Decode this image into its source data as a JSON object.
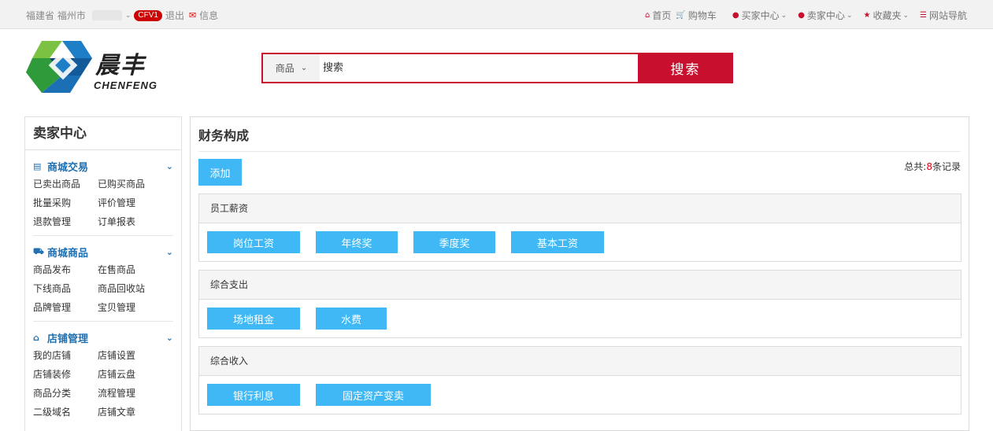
{
  "topbar": {
    "location": "福建省 福州市",
    "badge": "CFV1",
    "logout": "退出",
    "message": "信息",
    "nav": [
      {
        "icon": "home-icon",
        "glyph": "⌂",
        "label": "首页",
        "dropdown": false
      },
      {
        "icon": "cart-icon",
        "glyph": "🛒",
        "label": "购物车",
        "dropdown": false
      },
      {
        "icon": "user-icon",
        "glyph": "●",
        "label": "买家中心",
        "dropdown": true
      },
      {
        "icon": "user-icon",
        "glyph": "●",
        "label": "卖家中心",
        "dropdown": true
      },
      {
        "icon": "star-icon",
        "glyph": "★",
        "label": "收藏夹",
        "dropdown": true
      },
      {
        "icon": "list-icon",
        "glyph": "☰",
        "label": "网站导航",
        "dropdown": false
      }
    ]
  },
  "logo": {
    "cn": "晨丰",
    "en": "CHENFENG"
  },
  "search": {
    "category": "商品",
    "placeholder": "搜索",
    "button": "搜索"
  },
  "sidebar": {
    "title": "卖家中心",
    "groups": [
      {
        "icon": "card-icon",
        "title": "商城交易",
        "links": [
          "已卖出商品",
          "已购买商品",
          "批量采购",
          "评价管理",
          "退款管理",
          "订单报表"
        ]
      },
      {
        "icon": "truck-icon",
        "title": "商城商品",
        "links": [
          "商品发布",
          "在售商品",
          "下线商品",
          "商品回收站",
          "品牌管理",
          "宝贝管理"
        ]
      },
      {
        "icon": "home-icon",
        "title": "店铺管理",
        "links": [
          "我的店铺",
          "店铺设置",
          "店铺装修",
          "店铺云盘",
          "商品分类",
          "流程管理",
          "二级域名",
          "店铺文章"
        ]
      }
    ]
  },
  "main": {
    "title": "财务构成",
    "add_button": "添加",
    "total_prefix": "总共:",
    "total_count": "8",
    "total_suffix": "条记录",
    "sections": [
      {
        "title": "员工薪资",
        "items": [
          "岗位工资",
          "年终奖",
          "季度奖",
          "基本工资"
        ]
      },
      {
        "title": "综合支出",
        "items": [
          "场地租金",
          "水费"
        ]
      },
      {
        "title": "综合收入",
        "items": [
          "银行利息",
          "固定资产变卖"
        ]
      }
    ]
  },
  "colors": {
    "brand_red": "#c8102e",
    "button_blue": "#3fb8f5",
    "link_blue": "#1f6fb2"
  }
}
